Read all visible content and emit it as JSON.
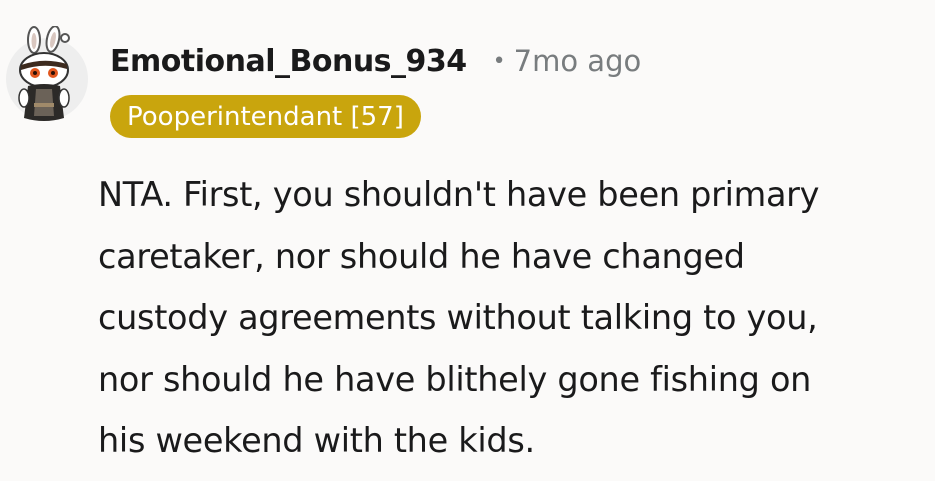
{
  "comment": {
    "author": {
      "username": "Emotional_Bonus_934",
      "avatar_icon": "snoo-avatar-icon"
    },
    "separator": "•",
    "timestamp": "7mo ago",
    "flair": {
      "text": "Pooperintendant [57]",
      "color": "#c9a50d"
    },
    "body_lines": [
      "NTA. First, you shouldn't have been primary",
      "caretaker, nor should he have changed",
      "custody agreements without talking to you,",
      "nor should he have blithely gone fishing on",
      "his weekend with the kids."
    ]
  }
}
